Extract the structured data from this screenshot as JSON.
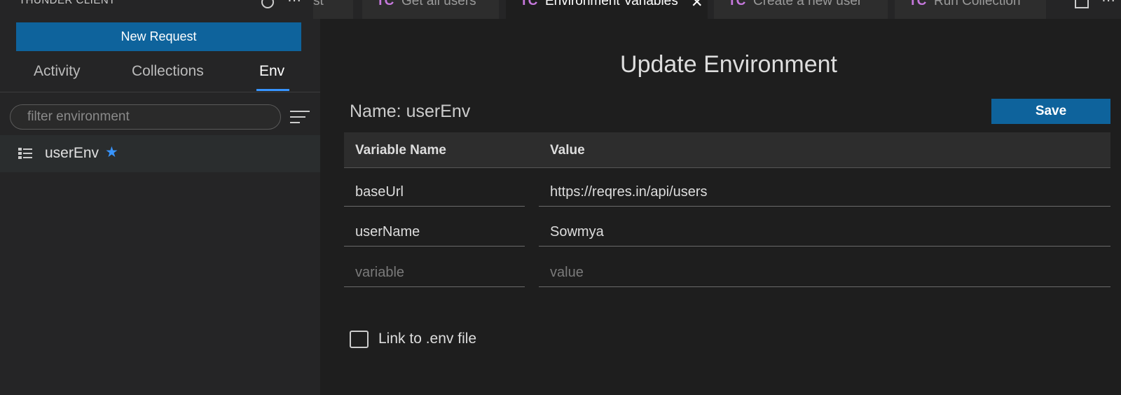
{
  "sidebar": {
    "header_title": "THUNDER CLIENT",
    "new_request_label": "New Request",
    "tabs": [
      {
        "label": "Activity"
      },
      {
        "label": "Collections"
      },
      {
        "label": "Env"
      }
    ],
    "active_tab": "Env",
    "filter_placeholder": "filter environment",
    "environments": [
      {
        "name": "userEnv",
        "starred": true
      }
    ]
  },
  "tabbar": {
    "tabs": [
      {
        "label": "st",
        "icon": "TC",
        "active": false
      },
      {
        "label": "Get all users",
        "icon": "TC",
        "active": false
      },
      {
        "label": "Environment Variables",
        "icon": "TC",
        "active": true
      },
      {
        "label": "Create a new user",
        "icon": "TC",
        "active": false
      },
      {
        "label": "Run Collection",
        "icon": "TC",
        "active": false
      }
    ]
  },
  "main": {
    "title": "Update Environment",
    "name_label": "Name: userEnv",
    "save_label": "Save",
    "table": {
      "headers": [
        "Variable Name",
        "Value"
      ],
      "rows": [
        {
          "name": "baseUrl",
          "value": "https://reqres.in/api/users"
        },
        {
          "name": "userName",
          "value": "Sowmya"
        }
      ],
      "new_row": {
        "name_placeholder": "variable",
        "value_placeholder": "value"
      }
    },
    "link_env_label": "Link to .env file",
    "link_env_checked": false
  },
  "colors": {
    "accent_blue": "#0e639c",
    "tab_underline": "#3794ff",
    "star": "#3794ff",
    "tc_icon": "#c678dd"
  }
}
